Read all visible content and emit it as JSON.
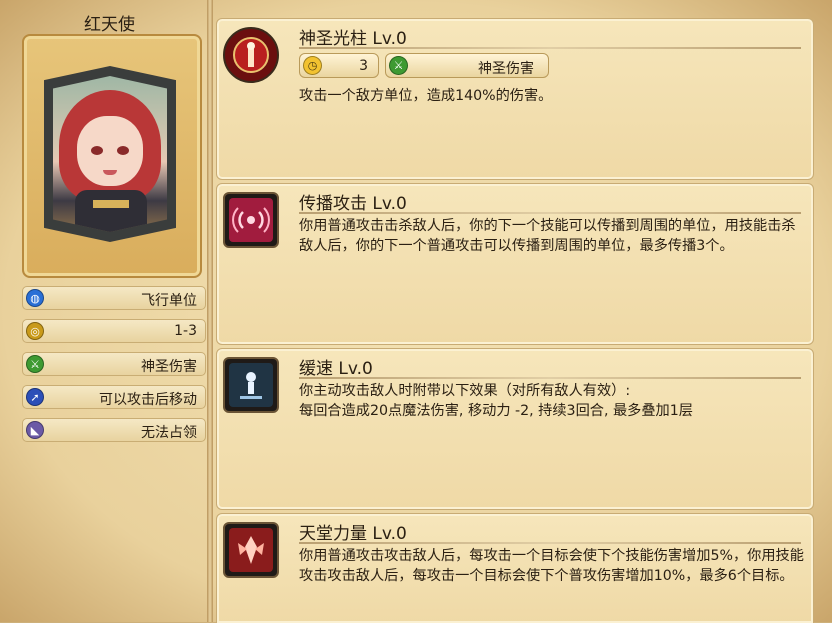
{
  "hero": {
    "name": "红天使",
    "portrait": "red-haired-angel-portrait"
  },
  "stats": [
    {
      "label": "飞行单位",
      "icon": "flying-unit-icon",
      "color": "#2a6fd6"
    },
    {
      "label": "1-3",
      "icon": "range-icon",
      "color": "#c99a1a"
    },
    {
      "label": "神圣伤害",
      "icon": "holy-damage-icon",
      "color": "#3e9a32"
    },
    {
      "label": "可以攻击后移动",
      "icon": "move-after-attack-icon",
      "color": "#2c4fb8"
    },
    {
      "label": "无法占领",
      "icon": "cannot-capture-icon",
      "color": "#6b5aa6"
    }
  ],
  "skills": [
    {
      "title": "神圣光柱 Lv.0",
      "icon": "holy-pillar-icon",
      "chips": [
        {
          "icon": "clock-icon",
          "text": "3"
        },
        {
          "icon": "holy-damage-icon",
          "text": "神圣伤害"
        }
      ],
      "desc": "攻击一个敌方单位，造成140%的伤害。"
    },
    {
      "title": "传播攻击 Lv.0",
      "icon": "spread-attack-icon",
      "desc": "你用普通攻击击杀敌人后，你的下一个技能可以传播到周围的单位，用技能击杀敌人后，你的下一个普通攻击可以传播到周围的单位，最多传播3个。"
    },
    {
      "title": "缓速 Lv.0",
      "icon": "slow-icon",
      "desc_lines": [
        "你主动攻击敌人时附带以下效果（对所有敌人有效）:",
        "每回合造成20点魔法伤害, 移动力 -2, 持续3回合, 最多叠加1层"
      ]
    },
    {
      "title": "天堂力量 Lv.0",
      "icon": "heaven-power-icon",
      "desc": "你用普通攻击攻击敌人后，每攻击一个目标会使下个技能伤害增加5%，你用技能攻击攻击敌人后，每攻击一个目标会使下个普攻伤害增加10%，最多6个目标。"
    }
  ]
}
